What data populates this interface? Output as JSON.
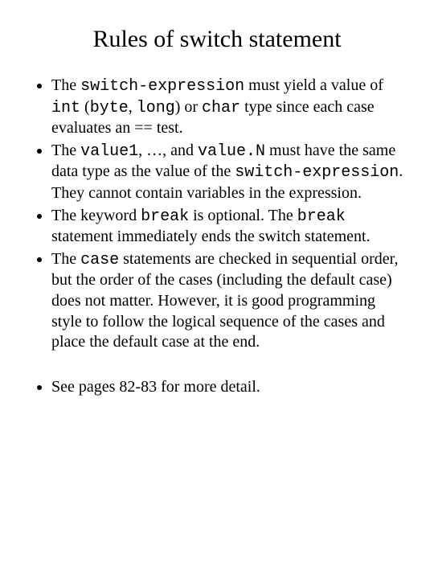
{
  "title": "Rules of switch statement",
  "b1": {
    "t1": "The ",
    "c1": "switch-expression",
    "t2": " must yield a value of ",
    "c2": "int",
    "t3": " (",
    "c3": "byte",
    "t4": ", ",
    "c4": "long",
    "t5": ") or ",
    "c5": "char",
    "t6": " type since each case evaluates an == test."
  },
  "b2": {
    "t1": "The ",
    "c1": "value1",
    "t2": ", …, and ",
    "c2": "value.N",
    "t3": " must have the same data type as the value of the ",
    "c3": "switch-expression",
    "t4": ".  They cannot contain variables in the expression."
  },
  "b3": {
    "t1": "The keyword ",
    "c1": "break",
    "t2": " is optional.  The ",
    "c2": "break",
    "t3": " statement immediately ends the switch statement."
  },
  "b4": {
    "t1": "The ",
    "c1": "case",
    "t2": " statements are checked in sequential order, but the order of the cases (including the default case) does not matter.  However, it is good programming style to follow the logical sequence of the cases and place the default case at the end."
  },
  "b5": {
    "t1": "See pages 82-83 for more detail."
  }
}
